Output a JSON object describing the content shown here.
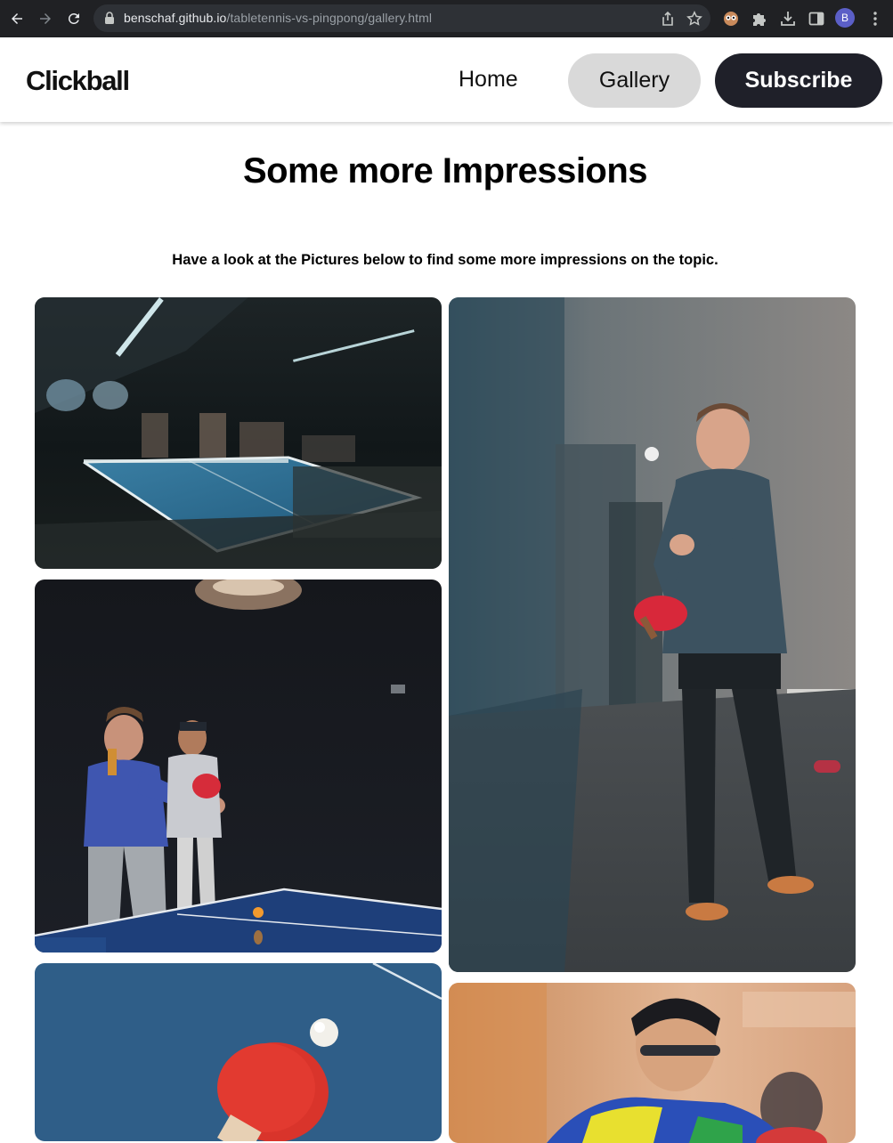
{
  "browser": {
    "url_host": "benschaf.github.io",
    "url_path": "/tabletennis-vs-pingpong/gallery.html",
    "profile_initial": "B",
    "icons": [
      "back-icon",
      "forward-icon",
      "reload-icon",
      "lock-icon",
      "share-icon",
      "star-icon",
      "extension-owl-icon",
      "puzzle-icon",
      "download-icon",
      "sidebar-icon",
      "more-icon"
    ]
  },
  "header": {
    "logo": "Clickball",
    "nav": {
      "home": "Home",
      "gallery": "Gallery",
      "subscribe": "Subscribe"
    },
    "colors": {
      "gallery_bg": "#d9d9d9",
      "subscribe_bg": "#1f2029"
    }
  },
  "main": {
    "title": "Some more Impressions",
    "subtitle": "Have a look at the Pictures below to find some more impressions on the topic."
  },
  "gallery": {
    "images": [
      "table-tennis-hall-photo",
      "player-serving-photo",
      "two-men-playing-photo",
      "paddle-and-ball-photo",
      "tournament-player-photo"
    ]
  }
}
